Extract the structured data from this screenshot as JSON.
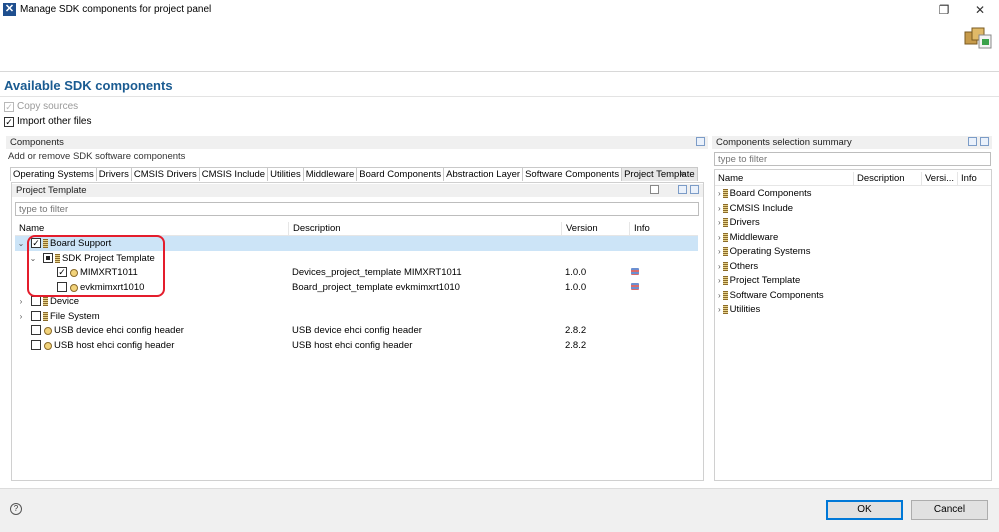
{
  "window": {
    "title": "Manage SDK components for project panel",
    "app_icon": "x-logo-icon"
  },
  "heading": "Available SDK components",
  "options": {
    "copy_sources": {
      "label": "Copy sources",
      "checked": true,
      "enabled": false
    },
    "import_other_files": {
      "label": "Import other files",
      "checked": true,
      "enabled": true
    }
  },
  "components_panel": {
    "title": "Components",
    "subtitle": "Add or remove SDK software components",
    "tabs": [
      "Operating Systems",
      "Drivers",
      "CMSIS Drivers",
      "CMSIS Include",
      "Utilities",
      "Middleware",
      "Board Components",
      "Abstraction Layer",
      "Software Components",
      "Project Template"
    ],
    "active_tab": "Project Template",
    "more_tabs": "»",
    "section_title": "Project Template",
    "filter_placeholder": "type to filter",
    "columns": {
      "name": "Name",
      "description": "Description",
      "version": "Version",
      "info": "Info"
    },
    "rows": [
      {
        "name": "Board Support",
        "description": "",
        "version": "",
        "check": "checked",
        "type": "folder",
        "expanded": true,
        "level": 0,
        "selected": true
      },
      {
        "name": "SDK Project Template",
        "description": "",
        "version": "",
        "check": "partial",
        "type": "folder",
        "expanded": true,
        "level": 1
      },
      {
        "name": "MIMXRT1011",
        "description": "Devices_project_template MIMXRT1011",
        "version": "1.0.0",
        "check": "checked",
        "type": "component",
        "level": 2,
        "info": true
      },
      {
        "name": "evkmimxrt1010",
        "description": "Board_project_template evkmimxrt1010",
        "version": "1.0.0",
        "check": "unchecked",
        "type": "component",
        "level": 2,
        "info": true
      },
      {
        "name": "Device",
        "description": "",
        "version": "",
        "check": "unchecked",
        "type": "folder",
        "expanded": false,
        "level": 0
      },
      {
        "name": "File System",
        "description": "",
        "version": "",
        "check": "unchecked",
        "type": "folder",
        "expanded": false,
        "level": 0
      },
      {
        "name": "USB device ehci config header",
        "description": "USB device ehci config header",
        "version": "2.8.2",
        "check": "unchecked",
        "type": "component",
        "level": 0
      },
      {
        "name": "USB host ehci config header",
        "description": "USB host ehci config header",
        "version": "2.8.2",
        "check": "unchecked",
        "type": "component",
        "level": 0
      }
    ]
  },
  "summary_panel": {
    "title": "Components selection summary",
    "filter_placeholder": "type to filter",
    "columns": {
      "name": "Name",
      "description": "Description",
      "version": "Versi...",
      "info": "Info"
    },
    "items": [
      "Board Components",
      "CMSIS Include",
      "Drivers",
      "Middleware",
      "Operating Systems",
      "Others",
      "Project Template",
      "Software Components",
      "Utilities"
    ]
  },
  "buttons": {
    "ok": "OK",
    "cancel": "Cancel",
    "help": "?"
  },
  "colors": {
    "heading": "#1a5b91",
    "selected_row": "#cce4f7",
    "highlight": "#e41d2c",
    "default_button": "#0078d7"
  }
}
